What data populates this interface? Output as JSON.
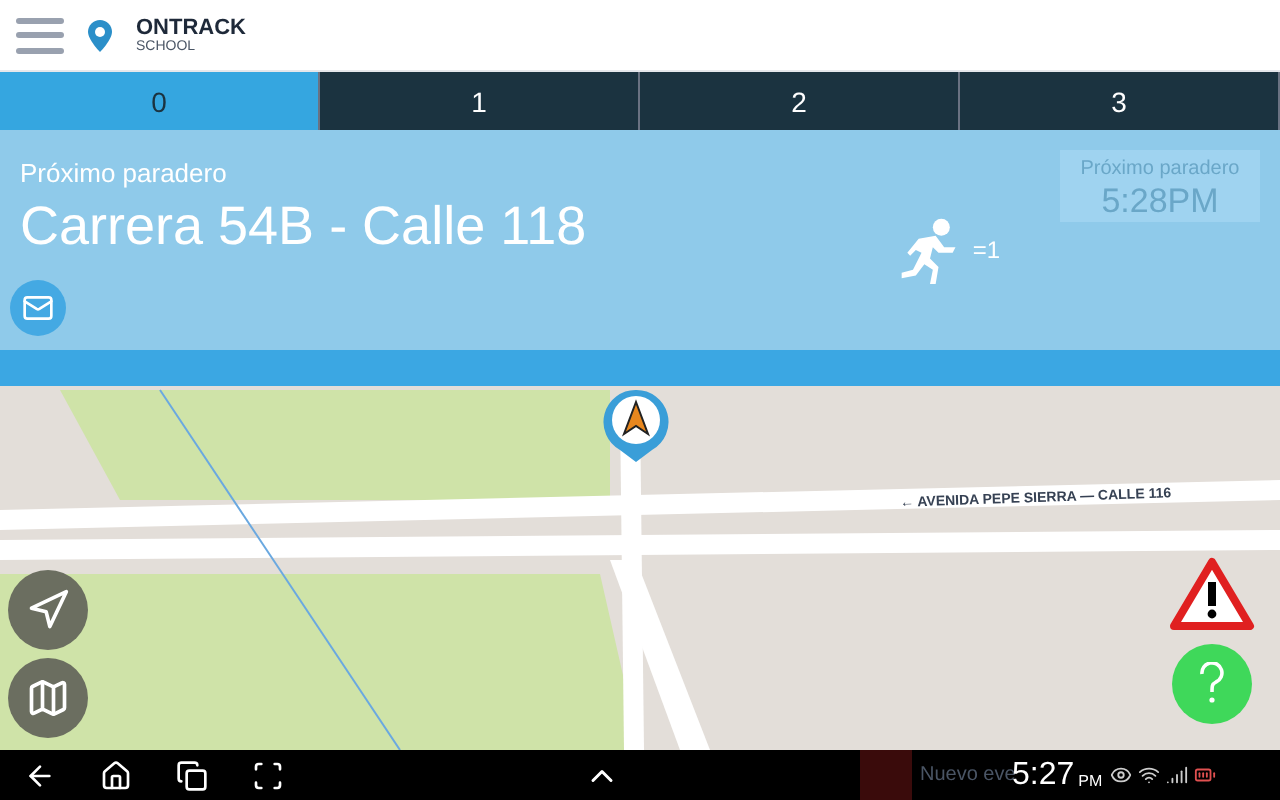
{
  "app": {
    "logo_name": "ONTRACK",
    "logo_sub": "SCHOOL"
  },
  "tabs": [
    {
      "label": "0",
      "selected": true
    },
    {
      "label": "1",
      "selected": false
    },
    {
      "label": "2",
      "selected": false
    },
    {
      "label": "3",
      "selected": false
    }
  ],
  "next_stop": {
    "caption": "Próximo paradero",
    "name": "Carrera 54B - Calle 118",
    "passengers": "=1",
    "eta_caption": "Próximo paradero",
    "eta": "5:28PM"
  },
  "map": {
    "street_label": "← AVENIDA PEPE SIERRA — CALLE 116"
  },
  "status_bar": {
    "notification": "Nuevo eve",
    "time": "5:27",
    "ampm": "PM"
  }
}
